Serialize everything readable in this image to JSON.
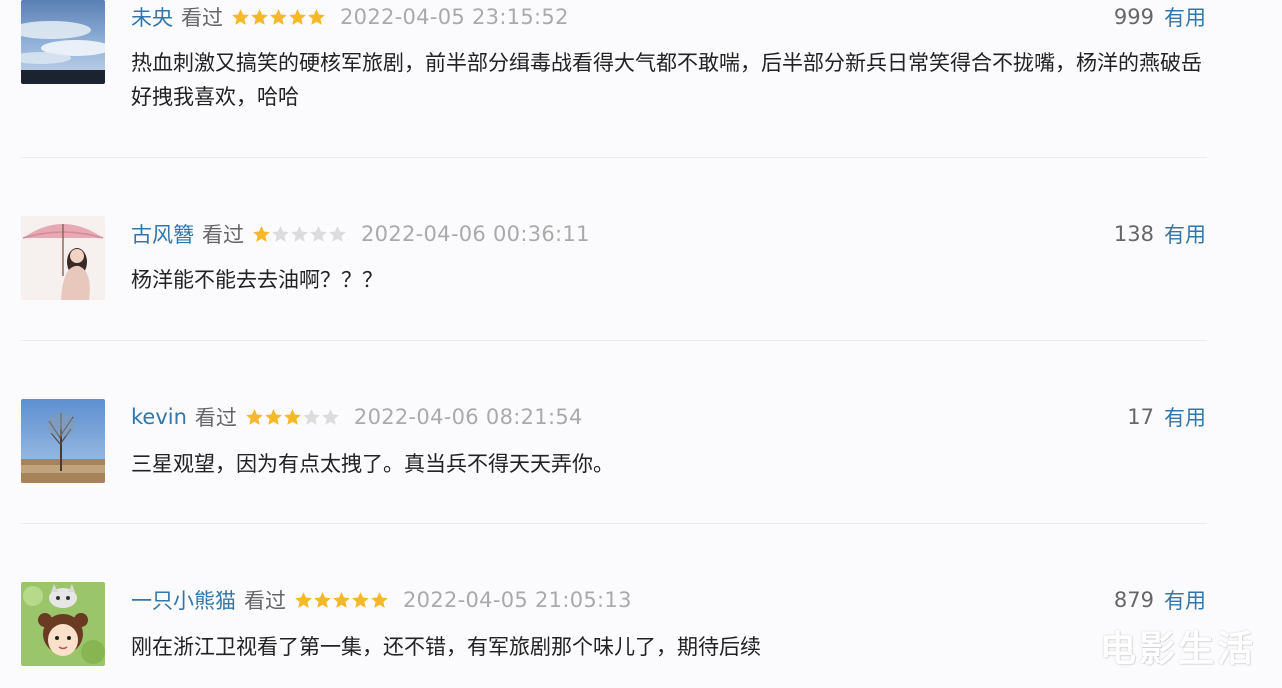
{
  "colors": {
    "username": "#3377aa",
    "star_full": "#f5b829",
    "star_empty": "#dcdcdc",
    "timestamp": "#aaaaaa",
    "text": "#222222"
  },
  "watermark": "电影生活",
  "comments": [
    {
      "user": "未央",
      "status": "看过",
      "rating": 5,
      "time": "2022-04-05 23:15:52",
      "votes": "999",
      "useful_label": "有用",
      "text": "热血刺激又搞笑的硬核军旅剧，前半部分缉毒战看得大气都不敢喘，后半部分新兵日常笑得合不拢嘴，杨洋的燕破岳好拽我喜欢，哈哈",
      "avatar": "sky-clouds-avatar"
    },
    {
      "user": "古风簪",
      "status": "看过",
      "rating": 1,
      "time": "2022-04-06 00:36:11",
      "votes": "138",
      "useful_label": "有用",
      "text": "杨洋能不能去去油啊？？？",
      "avatar": "umbrella-girl-avatar"
    },
    {
      "user": "kevin",
      "status": "看过",
      "rating": 3,
      "time": "2022-04-06 08:21:54",
      "votes": "17",
      "useful_label": "有用",
      "text": "三星观望，因为有点太拽了。真当兵不得天天弄你。",
      "avatar": "lone-tree-avatar"
    },
    {
      "user": "一只小熊猫",
      "status": "看过",
      "rating": 5,
      "time": "2022-04-05 21:05:13",
      "votes": "879",
      "useful_label": "有用",
      "text": "刚在浙江卫视看了第一集，还不错，有军旅剧那个味儿了，期待后续",
      "avatar": "cartoon-girl-cat-avatar"
    }
  ]
}
